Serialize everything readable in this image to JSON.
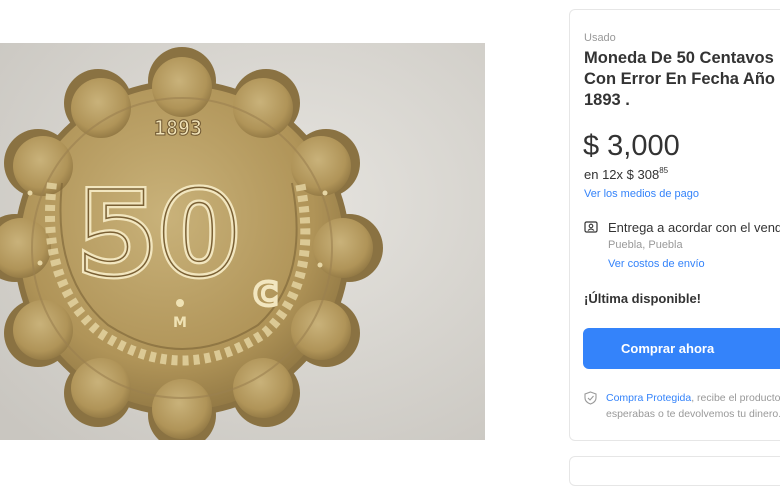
{
  "product": {
    "condition": "Usado",
    "title": "Moneda De 50 Centavos\nCon Error En Fecha Año\n1893 .",
    "currency_symbol": "$",
    "price": "3,000",
    "installments_prefix": "en 12x $ 308",
    "installments_cents": "85",
    "payment_methods_link": "Ver los medios de pago"
  },
  "shipping": {
    "title": "Entrega a acordar con el vendedor",
    "location": "Puebla, Puebla",
    "costs_link": "Ver costos de envío",
    "icon": "id-card-icon"
  },
  "stock": {
    "label": "¡Última disponible!"
  },
  "actions": {
    "buy_now": "Comprar ahora"
  },
  "protection": {
    "link": "Compra Protegida",
    "text": ", recibe el producto que esperabas o te devolvemos tu dinero.",
    "icon": "shield-check-icon"
  },
  "coin": {
    "year": "1893",
    "denomination": "50",
    "cents_mark": "c",
    "mint_mark": "M"
  },
  "colors": {
    "accent": "#3483fa",
    "coin": "#b39a5e",
    "background_photo": "#d8d6d2"
  }
}
